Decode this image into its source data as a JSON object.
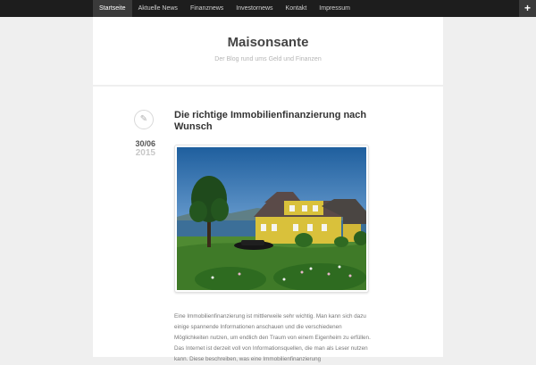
{
  "nav": {
    "items": [
      {
        "label": "Startseite",
        "active": true
      },
      {
        "label": "Aktuelle News",
        "active": false
      },
      {
        "label": "Finanznews",
        "active": false
      },
      {
        "label": "Investornews",
        "active": false
      },
      {
        "label": "Kontakt",
        "active": false
      },
      {
        "label": "Impressum",
        "active": false
      }
    ],
    "toggle_icon": "plus-icon",
    "toggle_glyph": "+"
  },
  "header": {
    "site_title": "Maisonsante",
    "tagline": "Der Blog rund ums Geld und Finanzen"
  },
  "post": {
    "format_icon": "pencil-icon",
    "format_glyph": "✎",
    "date_day": "30/06",
    "date_year": "2015",
    "title": "Die richtige Immobilienfinanzierung nach Wunsch",
    "image_subject": "yellow-house-by-sea",
    "excerpt": "Eine Immobilienfinanzierung ist mittlerweile sehr wichtig. Man kann sich dazu einige spannende Informationen anschauen und die verschiedenen Möglichkeiten nutzen, um endlich den Traum von einem Eigenheim zu erfüllen. Das Internet ist derzeit voll von Informationsquellen, die man als Leser nutzen kann. Diese beschreiben, was eine Immobilienfinanzierung"
  },
  "colors": {
    "topbar": "#1d1d1d",
    "active_nav": "#3a3a3a",
    "page_bg": "#efefef",
    "title_text": "#444444",
    "muted_text": "#b5b5b5"
  }
}
